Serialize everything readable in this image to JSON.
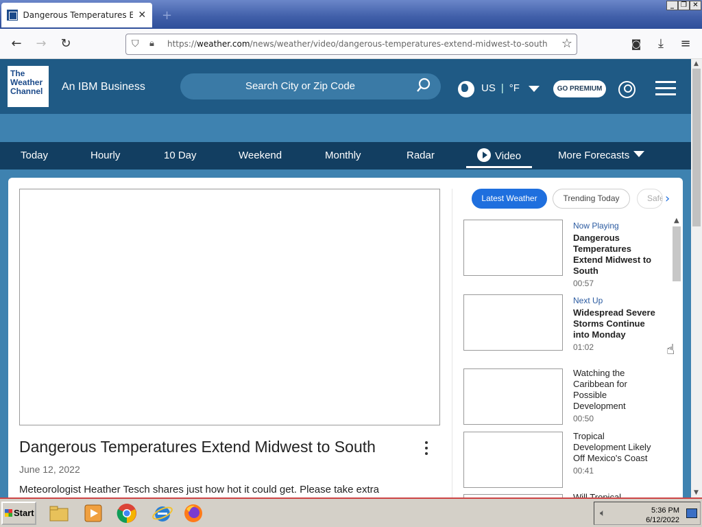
{
  "browser": {
    "tab_title": "Dangerous Temperatures Extend Mi",
    "url_prefix": "https://",
    "url_domain": "weather.com",
    "url_path": "/news/weather/video/dangerous-temperatures-extend-midwest-to-south",
    "new_tab": "+",
    "close_tab": "✕"
  },
  "header": {
    "logo_lines": [
      "The",
      "Weather",
      "Channel"
    ],
    "tagline": "An IBM Business",
    "search_placeholder": "Search City or Zip Code",
    "region": "US",
    "unit": "°F",
    "premium_label": "GO PREMIUM"
  },
  "nav": {
    "items": [
      "Today",
      "Hourly",
      "10 Day",
      "Weekend",
      "Monthly",
      "Radar",
      "Video",
      "More Forecasts"
    ]
  },
  "video": {
    "title": "Dangerous Temperatures Extend Midwest to South",
    "date": "June 12, 2022",
    "description": "Meteorologist Heather Tesch shares just how hot it could get. Please take extra"
  },
  "playlist": {
    "tabs": [
      "Latest Weather",
      "Trending Today",
      "Safet"
    ],
    "items": [
      {
        "status": "Now Playing",
        "title": "Dangerous Temperatures Extend Midwest to South",
        "duration": "00:57",
        "bold": true
      },
      {
        "status": "Next Up",
        "title": "Widespread Severe Storms Continue into Monday",
        "duration": "01:02",
        "bold": true
      },
      {
        "status": "",
        "title": "Watching the Caribbean for Possible Development",
        "duration": "00:50",
        "bold": false
      },
      {
        "status": "",
        "title": "Tropical Development Likely Off Mexico's Coast",
        "duration": "00:41",
        "bold": false
      },
      {
        "status": "",
        "title": "Will Tropical",
        "duration": "",
        "bold": false
      }
    ]
  },
  "taskbar": {
    "start_label": "Start",
    "time": "5:36 PM",
    "date": "6/12/2022"
  }
}
